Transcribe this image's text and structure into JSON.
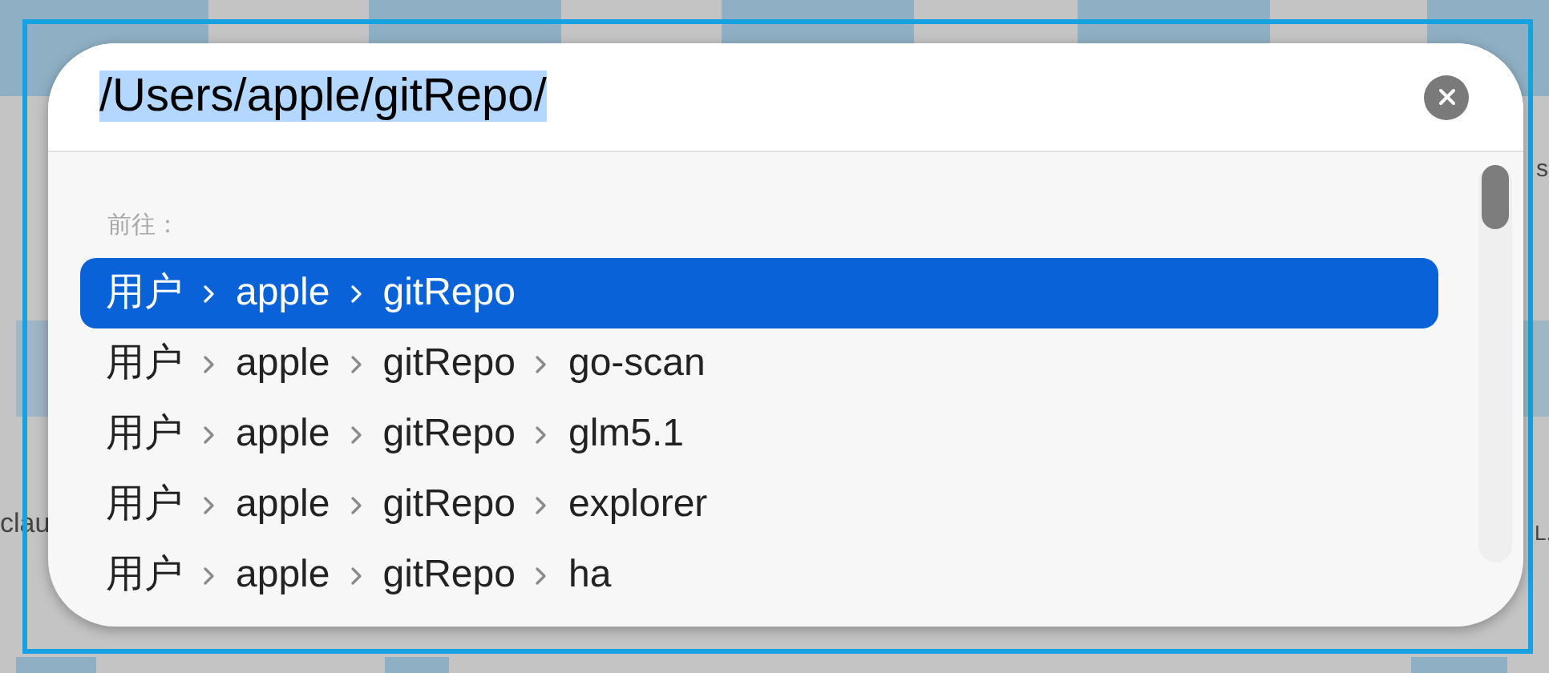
{
  "background": {
    "labels": [
      "s",
      "clau",
      "L."
    ]
  },
  "path_field": {
    "value": "/Users/apple/gitRepo/",
    "selected_text": true
  },
  "section_label": "前往：",
  "rows": [
    {
      "segments": [
        "用户",
        "apple",
        "gitRepo"
      ],
      "selected": true
    },
    {
      "segments": [
        "用户",
        "apple",
        "gitRepo",
        "go-scan"
      ],
      "selected": false
    },
    {
      "segments": [
        "用户",
        "apple",
        "gitRepo",
        "glm5.1"
      ],
      "selected": false
    },
    {
      "segments": [
        "用户",
        "apple",
        "gitRepo",
        "explorer"
      ],
      "selected": false
    },
    {
      "segments": [
        "用户",
        "apple",
        "gitRepo",
        "ha"
      ],
      "selected": false
    }
  ]
}
